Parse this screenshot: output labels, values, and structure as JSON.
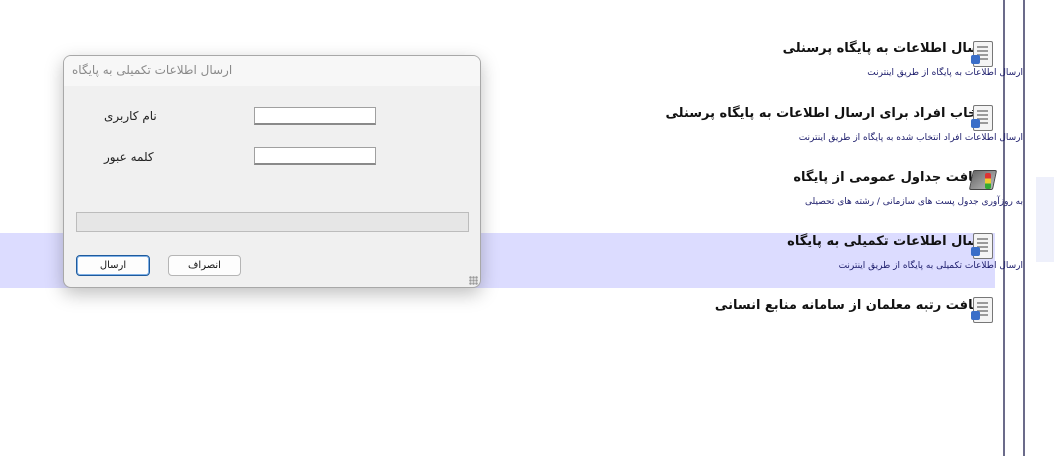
{
  "list": {
    "items": [
      {
        "title": "ارسال اطلاعات به پایگاه پرسنلی",
        "desc": "ارسال اطلاعات به پایگاه از طریق اینترنت",
        "icon": "document-icon"
      },
      {
        "title": "انتخاب افراد برای ارسال اطلاعات به پایگاه پرسنلی",
        "desc": "ارسال اطلاعات افراد انتخاب شده به پایگاه از طریق اینترنت",
        "icon": "document-icon"
      },
      {
        "title": "دریافت جداول عمومی از پایگاه",
        "desc": "به روزآوری جدول پست های سازمانی / رشته های تحصیلی",
        "icon": "book-icon"
      },
      {
        "title": "ارسال اطلاعات تکمیلی به پایگاه",
        "desc": "ارسال اطلاعات تکمیلی به پایگاه از طریق اینترنت",
        "icon": "document-icon",
        "selected": true
      },
      {
        "title": "دریافت رتبه معلمان از سامانه منابع انسانی",
        "desc": "",
        "icon": "document-icon"
      }
    ]
  },
  "dialog": {
    "title": "ارسال اطلاعات تکمیلی به پایگاه",
    "username_label": "نام کاربری",
    "username_value": "",
    "password_label": "کلمه عبور",
    "password_value": "",
    "progress": 0,
    "cancel_label": "انصراف",
    "send_label": "ارسال"
  },
  "colors": {
    "highlight": "#dcdcff",
    "desc_text": "#1a1a6a"
  }
}
